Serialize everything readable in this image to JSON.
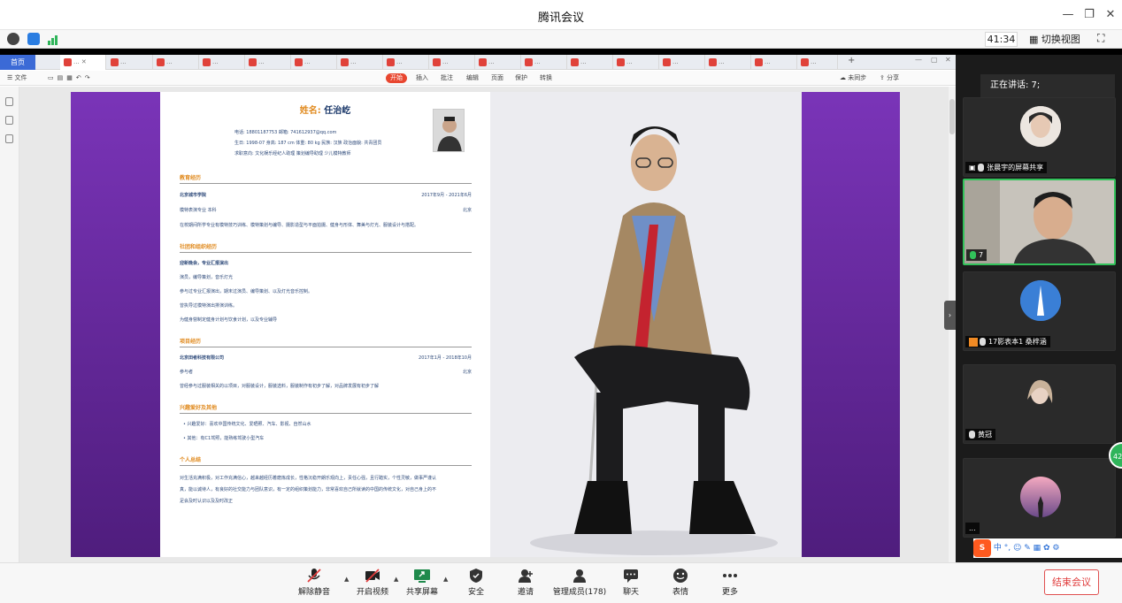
{
  "titlebar": {
    "title": "腾讯会议"
  },
  "infobar": {
    "timer": "41:34",
    "switch_view": "切换视图"
  },
  "wps": {
    "home_tab": "首页",
    "tab_label": "...",
    "toolbar": {
      "file": "文件",
      "menus": [
        "开始",
        "插入",
        "批注",
        "编辑",
        "页面",
        "保护",
        "转换"
      ],
      "sync": "未同步",
      "share": "分享"
    }
  },
  "resume": {
    "name_label": "姓名:",
    "name": "任治屹",
    "info_lines": [
      "电话: 18801187753  邮箱: 741612937@qq.com",
      "生日: 1998-07  身高: 187 cm  体重: 80 kg  民族: 汉族  政治面貌: 共青团员",
      "求职意向: 文化娱乐经纪人助理  策划编导助理  少儿模特教师"
    ],
    "sections": [
      {
        "title": "教育经历"
      },
      {
        "title": "社团和组织经历"
      },
      {
        "title": "项目经历"
      },
      {
        "title": "兴趣爱好及其他"
      },
      {
        "title": "个人总结"
      }
    ],
    "edu": {
      "school": "北京城市学院",
      "date": "2017年9月 - 2021年6月",
      "major": "模特表演专业 本科",
      "city": "北京",
      "desc": "在校期间所学专业有模特技巧训练、模特策划与编导、摄影造型与平面拍摄、健身与形体、舞美与灯光、服装设计与搭配。"
    },
    "club": {
      "title": "迎新晚会，专业汇报演出",
      "l1": "演员，编导策划，音乐灯光",
      "l2": "参与过专业汇报演出，期末过演员、编导策划、以及灯光音乐控制。",
      "l3": "曾执导过模特演出排演训练。",
      "l4": "为健身營制定健身计划与饮食计划，以及专业辅导"
    },
    "proj": {
      "company": "北京田者科技有限公司",
      "date": "2017年1月 - 2018年10月",
      "role": "参与者",
      "city": "北京",
      "desc": "曾经参与过服装相关的以项目，对服装设计，服装选料，服装制作有初步了解，对品牌发展有初步了解"
    },
    "hobby": {
      "l1": "兴趣爱好：喜欢中国传统文化、爱晒照、汽车、影视、自然山水",
      "l2": "其他：有C1驾照，能熟练驾驶小型汽车"
    },
    "summary": {
      "l1": "对生活充满积极，对工作充满信心，越来越经历着磨炼成长，性格沉稳开朗乐观向上，责任心强，且行踏实，个性灵敏，做事严谨认",
      "l2": "真，能以诚待人，有良好的社交能力与团队意识，有一定的组织策划能力，非常喜欢自己所就读的中国的传统文化，对自己身上的不",
      "l3": "足会及时认识以及及时改正"
    }
  },
  "meeting": {
    "speaking": "正在讲话: 7;",
    "participants": [
      {
        "name": "张晨宇的屏幕共享"
      },
      {
        "name": "7"
      },
      {
        "name": "17影表本1 桑梓涵"
      },
      {
        "name": "黄冠"
      },
      {
        "name": "..."
      }
    ],
    "ime": "中 °, ☺ ✎ ▦ ✿ ⚙",
    "badge": "42"
  },
  "bottom": {
    "buttons": [
      "解除静音",
      "开启视频",
      "共享屏幕",
      "安全",
      "邀请",
      "管理成员(178)",
      "聊天",
      "表情",
      "更多"
    ],
    "end": "结束会议"
  },
  "colors": {
    "accent": "#e08a1e",
    "purple": "#6b2aa8",
    "green": "#32c25a",
    "end": "#e03b3b"
  }
}
